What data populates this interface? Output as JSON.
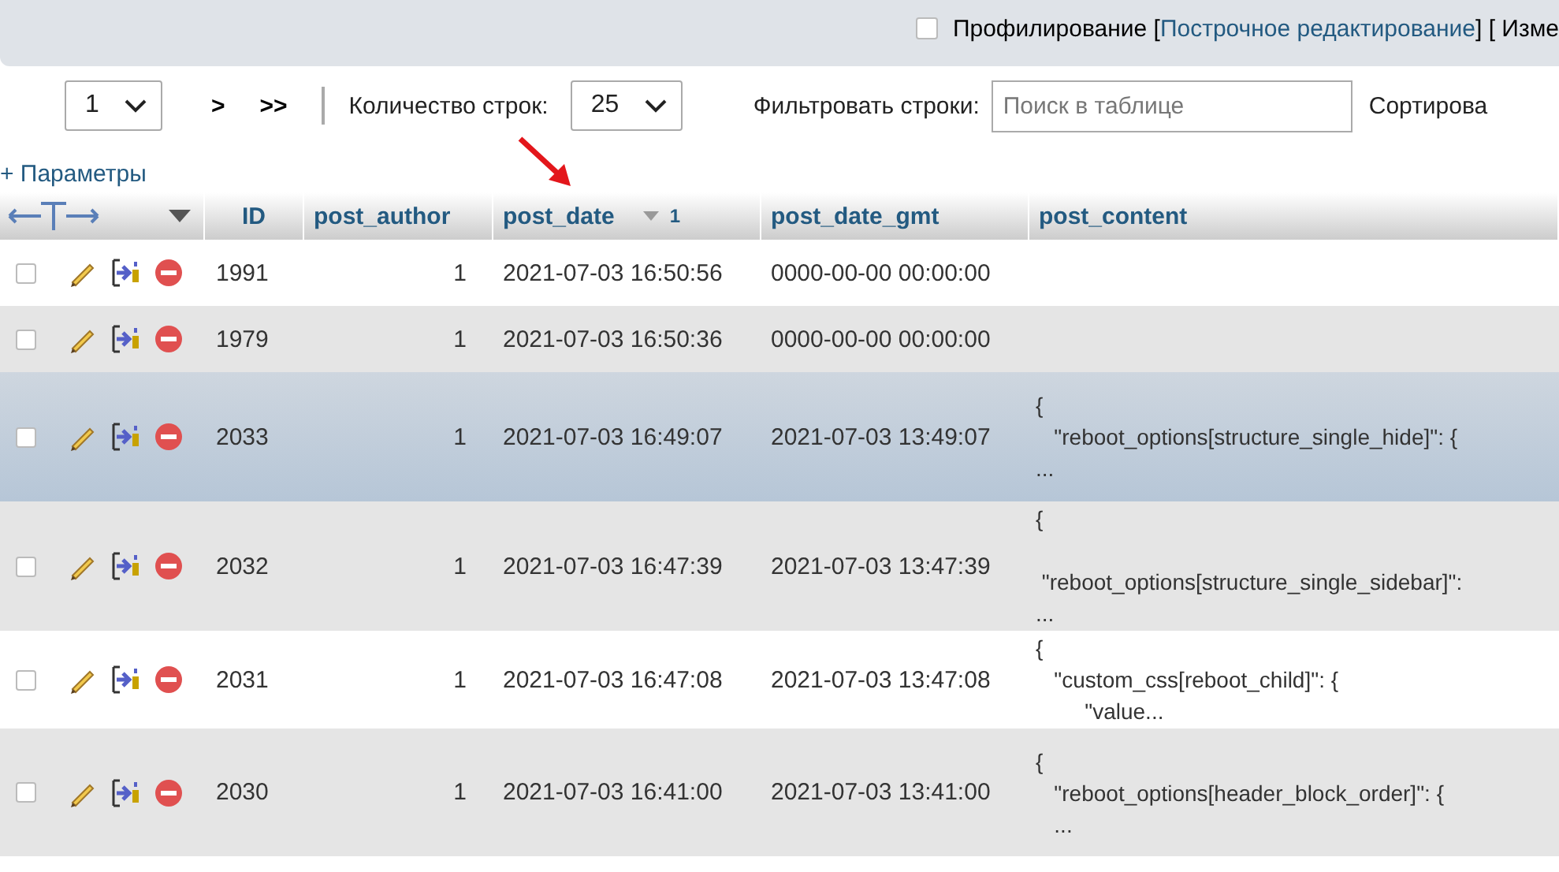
{
  "top_bar": {
    "profiling": {
      "label": "Профилирование [",
      "checked": false
    },
    "inline_edit_link": "Построчное редактирование",
    "after_link": "] [ Изме"
  },
  "navigation": {
    "page_select": "1",
    "next": ">",
    "last": ">>",
    "rows_label": "Количество строк:",
    "rows_select": "25",
    "filter_label": "Фильтровать строки:",
    "filter_field": {
      "placeholder": "Поиск в таблице"
    },
    "sort_label": "Сортирова"
  },
  "options_link": "+ Параметры",
  "table": {
    "columns": [
      {
        "label": "ID"
      },
      {
        "label": "post_author"
      },
      {
        "label": "post_date",
        "sort_order": "1"
      },
      {
        "label": "post_date_gmt"
      },
      {
        "label": "post_content"
      }
    ],
    "rows": [
      {
        "checked": false,
        "highlighted": false,
        "cells": [
          "1991",
          "1",
          "2021-07-03 16:50:56",
          "0000-00-00 00:00:00",
          ""
        ]
      },
      {
        "checked": false,
        "highlighted": false,
        "cells": [
          "1979",
          "1",
          "2021-07-03 16:50:36",
          "0000-00-00 00:00:00",
          ""
        ]
      },
      {
        "checked": false,
        "highlighted": true,
        "cells": [
          "2033",
          "1",
          "2021-07-03 16:49:07",
          "2021-07-03 13:49:07",
          "{\n   \"reboot_options[structure_single_hide]\": {\n..."
        ]
      },
      {
        "checked": false,
        "highlighted": false,
        "cells": [
          "2032",
          "1",
          "2021-07-03 16:47:39",
          "2021-07-03 13:47:39",
          "{\n\n \"reboot_options[structure_single_sidebar]\":\n..."
        ]
      },
      {
        "checked": false,
        "highlighted": false,
        "cells": [
          "2031",
          "1",
          "2021-07-03 16:47:08",
          "2021-07-03 13:47:08",
          "{\n   \"custom_css[reboot_child]\": {\n        \"value..."
        ]
      },
      {
        "checked": false,
        "highlighted": false,
        "cells": [
          "2030",
          "1",
          "2021-07-03 16:41:00",
          "2021-07-03 13:41:00",
          "{\n   \"reboot_options[header_block_order]\": {\n   ..."
        ]
      }
    ]
  }
}
